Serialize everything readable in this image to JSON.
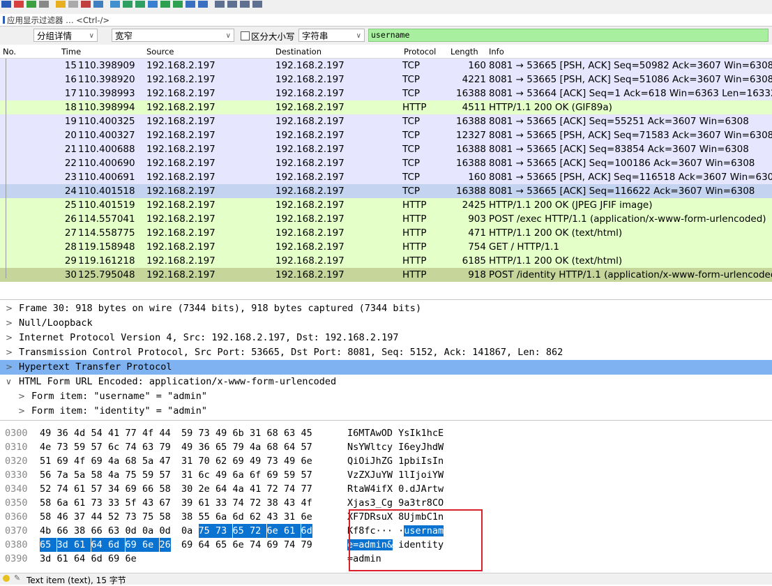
{
  "filter_bar": {
    "label": "应用显示过滤器 … <Ctrl-/>"
  },
  "find_bar": {
    "search_in": "分组详情",
    "char_width": "宽窄",
    "case_sensitive_label": "区分大小写",
    "search_type": "字符串",
    "search_value": "username"
  },
  "columns": [
    "No.",
    "Time",
    "Source",
    "Destination",
    "Protocol",
    "Length",
    "Info"
  ],
  "colors": {
    "tcp_row": "#e7e6ff",
    "http_row": "#e4ffc7",
    "selected_row": "#c6d59a",
    "marked_row": "#c4d4f0",
    "find_box": "#a8f0a0",
    "selection": "#0a72d0",
    "highlight_bar": "#7fb2f0"
  },
  "packets": [
    {
      "no": "15",
      "time": "110.398909",
      "src": "192.168.2.197",
      "dst": "192.168.2.197",
      "proto": "TCP",
      "len": "160",
      "info": "8081 → 53665 [PSH, ACK] Seq=50982 Ack=3607 Win=6308",
      "kind": "tcp"
    },
    {
      "no": "16",
      "time": "110.398920",
      "src": "192.168.2.197",
      "dst": "192.168.2.197",
      "proto": "TCP",
      "len": "4221",
      "info": "8081 → 53665 [PSH, ACK] Seq=51086 Ack=3607 Win=6308",
      "kind": "tcp"
    },
    {
      "no": "17",
      "time": "110.398993",
      "src": "192.168.2.197",
      "dst": "192.168.2.197",
      "proto": "TCP",
      "len": "16388",
      "info": "8081 → 53664 [ACK] Seq=1 Ack=618 Win=6363 Len=16332",
      "kind": "tcp"
    },
    {
      "no": "18",
      "time": "110.398994",
      "src": "192.168.2.197",
      "dst": "192.168.2.197",
      "proto": "HTTP",
      "len": "4511",
      "info": "HTTP/1.1 200 OK  (GIF89a)",
      "kind": "http"
    },
    {
      "no": "19",
      "time": "110.400325",
      "src": "192.168.2.197",
      "dst": "192.168.2.197",
      "proto": "TCP",
      "len": "16388",
      "info": "8081 → 53665 [ACK] Seq=55251 Ack=3607 Win=6308",
      "kind": "tcp"
    },
    {
      "no": "20",
      "time": "110.400327",
      "src": "192.168.2.197",
      "dst": "192.168.2.197",
      "proto": "TCP",
      "len": "12327",
      "info": "8081 → 53665 [PSH, ACK] Seq=71583 Ack=3607 Win=6308",
      "kind": "tcp"
    },
    {
      "no": "21",
      "time": "110.400688",
      "src": "192.168.2.197",
      "dst": "192.168.2.197",
      "proto": "TCP",
      "len": "16388",
      "info": "8081 → 53665 [ACK] Seq=83854 Ack=3607 Win=6308",
      "kind": "tcp"
    },
    {
      "no": "22",
      "time": "110.400690",
      "src": "192.168.2.197",
      "dst": "192.168.2.197",
      "proto": "TCP",
      "len": "16388",
      "info": "8081 → 53665 [ACK] Seq=100186 Ack=3607 Win=6308",
      "kind": "tcp"
    },
    {
      "no": "23",
      "time": "110.400691",
      "src": "192.168.2.197",
      "dst": "192.168.2.197",
      "proto": "TCP",
      "len": "160",
      "info": "8081 → 53665 [PSH, ACK] Seq=116518 Ack=3607 Win=6308",
      "kind": "tcp"
    },
    {
      "no": "24",
      "time": "110.401518",
      "src": "192.168.2.197",
      "dst": "192.168.2.197",
      "proto": "TCP",
      "len": "16388",
      "info": "8081 → 53665 [ACK] Seq=116622 Ack=3607 Win=6308",
      "kind": "marked"
    },
    {
      "no": "25",
      "time": "110.401519",
      "src": "192.168.2.197",
      "dst": "192.168.2.197",
      "proto": "HTTP",
      "len": "2425",
      "info": "HTTP/1.1 200 OK  (JPEG JFIF image)",
      "kind": "http"
    },
    {
      "no": "26",
      "time": "114.557041",
      "src": "192.168.2.197",
      "dst": "192.168.2.197",
      "proto": "HTTP",
      "len": "903",
      "info": "POST /exec HTTP/1.1  (application/x-www-form-urlencoded)",
      "kind": "http"
    },
    {
      "no": "27",
      "time": "114.558775",
      "src": "192.168.2.197",
      "dst": "192.168.2.197",
      "proto": "HTTP",
      "len": "471",
      "info": "HTTP/1.1 200 OK  (text/html)",
      "kind": "http"
    },
    {
      "no": "28",
      "time": "119.158948",
      "src": "192.168.2.197",
      "dst": "192.168.2.197",
      "proto": "HTTP",
      "len": "754",
      "info": "GET / HTTP/1.1",
      "kind": "http"
    },
    {
      "no": "29",
      "time": "119.161218",
      "src": "192.168.2.197",
      "dst": "192.168.2.197",
      "proto": "HTTP",
      "len": "6185",
      "info": "HTTP/1.1 200 OK  (text/html)",
      "kind": "http"
    },
    {
      "no": "30",
      "time": "125.795048",
      "src": "192.168.2.197",
      "dst": "192.168.2.197",
      "proto": "HTTP",
      "len": "918",
      "info": "POST /identity HTTP/1.1  (application/x-www-form-urlencoded)",
      "kind": "selected"
    }
  ],
  "details": [
    {
      "text": "Frame 30: 918 bytes on wire (7344 bits), 918 bytes captured (7344 bits)",
      "twisty": ">",
      "indent": 0,
      "highlight": false
    },
    {
      "text": "Null/Loopback",
      "twisty": ">",
      "indent": 0,
      "highlight": false
    },
    {
      "text": "Internet Protocol Version 4, Src: 192.168.2.197, Dst: 192.168.2.197",
      "twisty": ">",
      "indent": 0,
      "highlight": false
    },
    {
      "text": "Transmission Control Protocol, Src Port: 53665, Dst Port: 8081, Seq: 5152, Ack: 141867, Len: 862",
      "twisty": ">",
      "indent": 0,
      "highlight": false
    },
    {
      "text": "Hypertext Transfer Protocol",
      "twisty": ">",
      "indent": 0,
      "highlight": true
    },
    {
      "text": "HTML Form URL Encoded: application/x-www-form-urlencoded",
      "twisty": "∨",
      "indent": 0,
      "highlight": false
    },
    {
      "text": "Form item: \"username\" = \"admin\"",
      "twisty": ">",
      "indent": 1,
      "highlight": false
    },
    {
      "text": "Form item: \"identity\" = \"admin\"",
      "twisty": ">",
      "indent": 1,
      "highlight": false
    }
  ],
  "hex_rows": [
    {
      "offset": "0300",
      "bytes": [
        "49",
        "36",
        "4d",
        "54",
        "41",
        "77",
        "4f",
        "44",
        "59",
        "73",
        "49",
        "6b",
        "31",
        "68",
        "63",
        "45"
      ],
      "ascii": "I6MTAwOD YsIk1hcE",
      "sel_from": -1,
      "asc_sel": null
    },
    {
      "offset": "0310",
      "bytes": [
        "4e",
        "73",
        "59",
        "57",
        "6c",
        "74",
        "63",
        "79",
        "49",
        "36",
        "65",
        "79",
        "4a",
        "68",
        "64",
        "57"
      ],
      "ascii": "NsYWltcy I6eyJhdW",
      "sel_from": -1,
      "asc_sel": null
    },
    {
      "offset": "0320",
      "bytes": [
        "51",
        "69",
        "4f",
        "69",
        "4a",
        "68",
        "5a",
        "47",
        "31",
        "70",
        "62",
        "69",
        "49",
        "73",
        "49",
        "6e"
      ],
      "ascii": "QiOiJhZG 1pbiIsIn",
      "sel_from": -1,
      "asc_sel": null
    },
    {
      "offset": "0330",
      "bytes": [
        "56",
        "7a",
        "5a",
        "58",
        "4a",
        "75",
        "59",
        "57",
        "31",
        "6c",
        "49",
        "6a",
        "6f",
        "69",
        "59",
        "57"
      ],
      "ascii": "VzZXJuYW 1lIjoiYW",
      "sel_from": -1,
      "asc_sel": null
    },
    {
      "offset": "0340",
      "bytes": [
        "52",
        "74",
        "61",
        "57",
        "34",
        "69",
        "66",
        "58",
        "30",
        "2e",
        "64",
        "4a",
        "41",
        "72",
        "74",
        "77"
      ],
      "ascii": "RtaW4ifX 0.dJArtw",
      "sel_from": -1,
      "asc_sel": null
    },
    {
      "offset": "0350",
      "bytes": [
        "58",
        "6a",
        "61",
        "73",
        "33",
        "5f",
        "43",
        "67",
        "39",
        "61",
        "33",
        "74",
        "72",
        "38",
        "43",
        "4f"
      ],
      "ascii": "Xjas3_Cg 9a3tr8CO",
      "sel_from": -1,
      "asc_sel": null
    },
    {
      "offset": "0360",
      "bytes": [
        "58",
        "46",
        "37",
        "44",
        "52",
        "73",
        "75",
        "58",
        "38",
        "55",
        "6a",
        "6d",
        "62",
        "43",
        "31",
        "6e"
      ],
      "ascii": "XF7DRsuX 8UjmbC1n",
      "sel_from": -1,
      "asc_sel": null
    },
    {
      "offset": "0370",
      "bytes": [
        "4b",
        "66",
        "38",
        "66",
        "63",
        "0d",
        "0a",
        "0d",
        "0a",
        "75",
        "73",
        "65",
        "72",
        "6e",
        "61",
        "6d"
      ],
      "ascii": "Kf8fc··· ·usernam",
      "sel_from": 9,
      "asc_sel": {
        "plain": "Kf8fc··· ·",
        "marked": "usernam",
        "rest": ""
      }
    },
    {
      "offset": "0380",
      "bytes": [
        "65",
        "3d",
        "61",
        "64",
        "6d",
        "69",
        "6e",
        "26",
        "69",
        "64",
        "65",
        "6e",
        "74",
        "69",
        "74",
        "79"
      ],
      "ascii": "e=admin& identity",
      "sel_from": 0,
      "sel_to": 7,
      "asc_sel": {
        "plain": "",
        "marked": "e=admin&",
        "rest": " identity"
      }
    },
    {
      "offset": "0390",
      "bytes": [
        "3d",
        "61",
        "64",
        "6d",
        "69",
        "6e"
      ],
      "ascii": "=admin",
      "sel_from": -1,
      "asc_sel": null
    }
  ],
  "status": {
    "text": "Text item (text), 15 字节"
  }
}
